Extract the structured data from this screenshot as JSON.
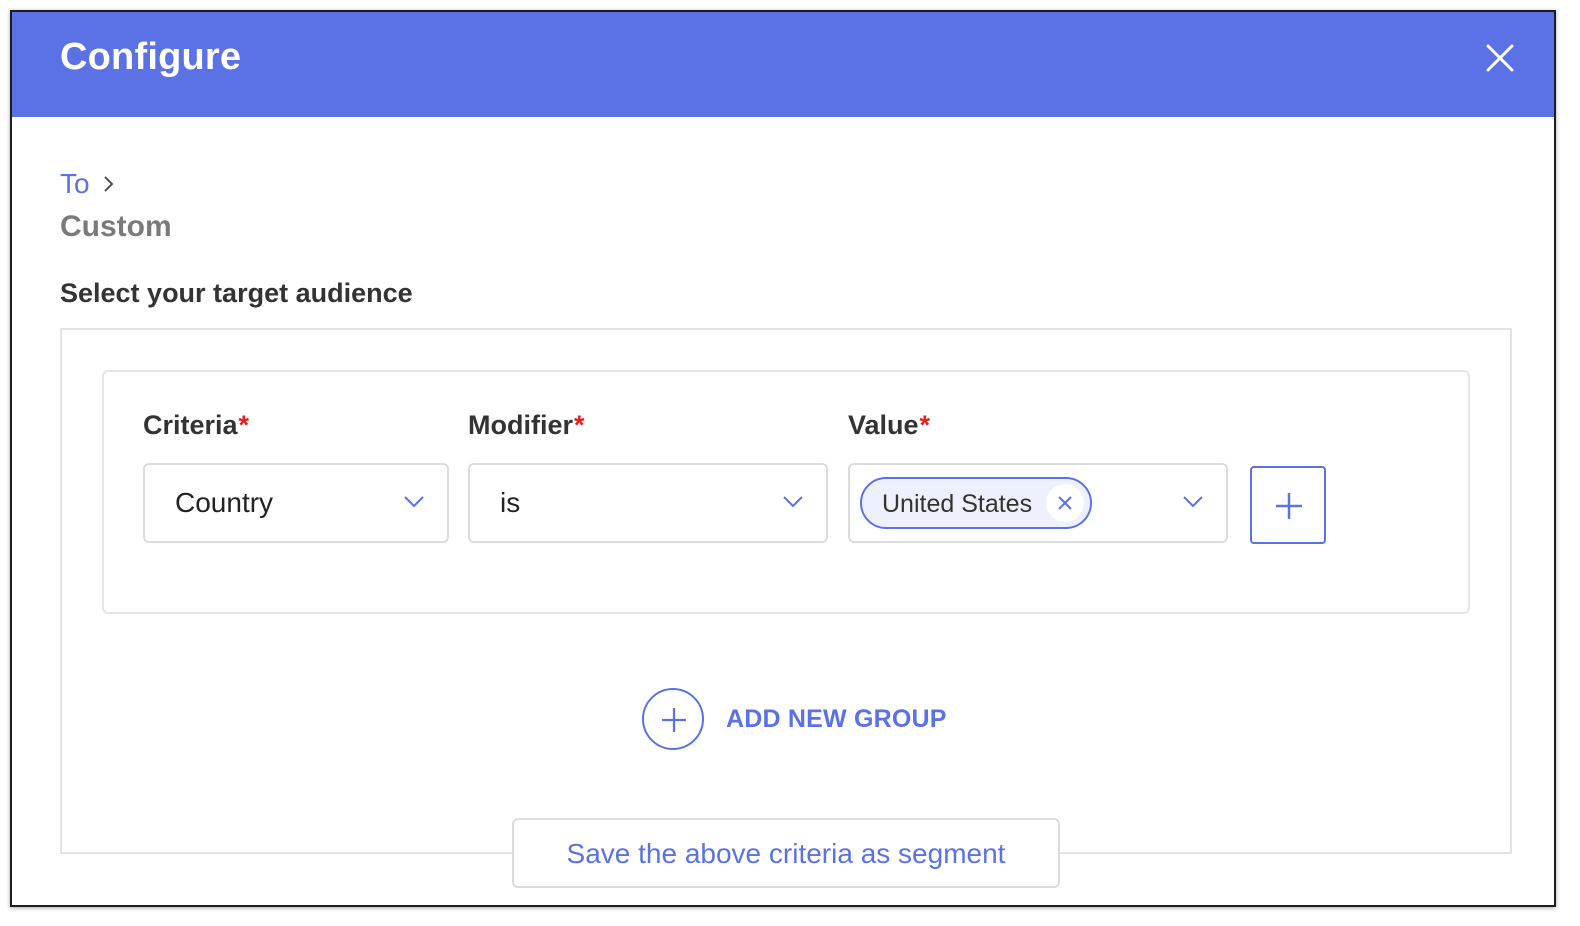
{
  "dialog": {
    "title": "Configure",
    "close_icon": "close-icon"
  },
  "breadcrumb": {
    "link": "To",
    "separator_icon": "chevron-right-icon",
    "current": "Custom"
  },
  "section": {
    "label": "Select your target audience"
  },
  "fields": {
    "criteria": {
      "label": "Criteria",
      "required": "*",
      "value": "Country"
    },
    "modifier": {
      "label": "Modifier",
      "required": "*",
      "value": "is"
    },
    "value": {
      "label": "Value",
      "required": "*",
      "chips": [
        "United States"
      ]
    }
  },
  "actions": {
    "add_new_group": "ADD NEW GROUP",
    "save_segment": "Save the above criteria as segment"
  },
  "colors": {
    "accent": "#5b72e6",
    "required": "#e02020",
    "heading": "#333333",
    "muted": "#7a7a7a"
  }
}
